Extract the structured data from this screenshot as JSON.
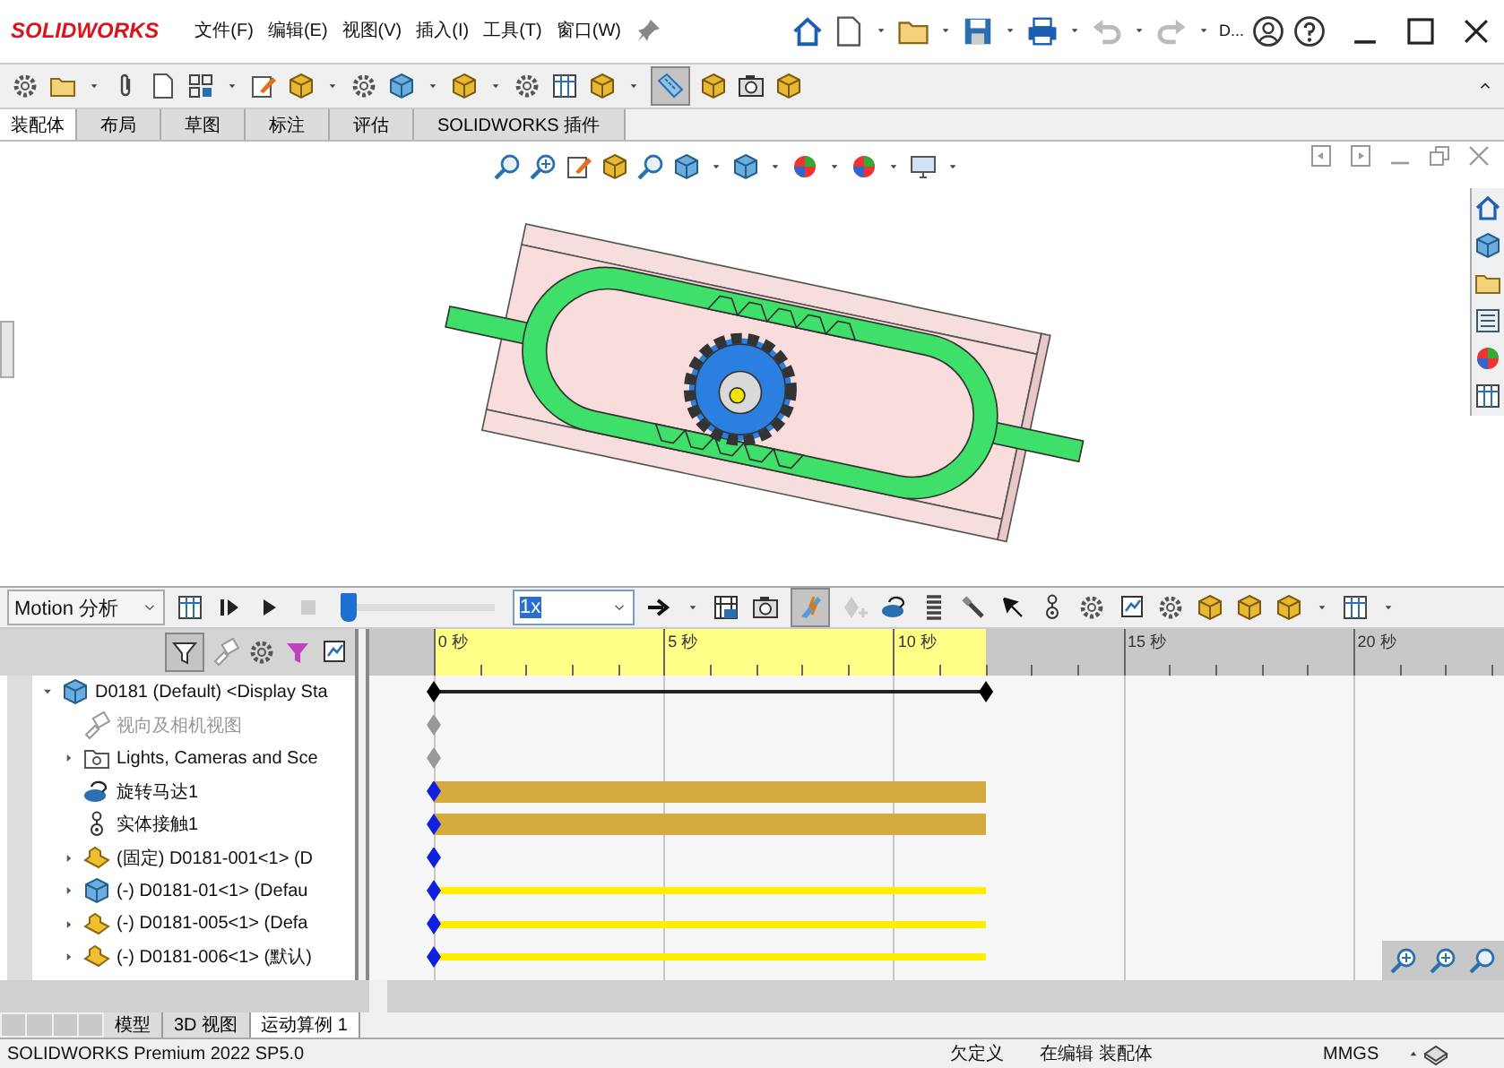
{
  "app": {
    "logo": "SOLIDWORKS",
    "menus": [
      "文件(F)",
      "编辑(E)",
      "视图(V)",
      "插入(I)",
      "工具(T)",
      "窗口(W)"
    ],
    "doc_title": "D..."
  },
  "command_toolbar": {
    "measure_pressed": true
  },
  "command_tabs": [
    {
      "label": "装配体",
      "selected": true
    },
    {
      "label": "布局",
      "selected": false
    },
    {
      "label": "草图",
      "selected": false
    },
    {
      "label": "标注",
      "selected": false
    },
    {
      "label": "评估",
      "selected": false
    },
    {
      "label": "SOLIDWORKS 插件",
      "selected": false
    }
  ],
  "motion": {
    "study_type": "Motion 分析",
    "slider": {
      "level": 0
    },
    "speed": "1x",
    "calc_pressed": true,
    "filter_pressed": true
  },
  "ruler": {
    "level": 0.516,
    "ticks": [
      "0 秒",
      "5 秒",
      "10 秒",
      "15 秒",
      "20 秒"
    ]
  },
  "tree": [
    {
      "label": "D0181 (Default) <Display Sta",
      "kind": "span",
      "expanded": true,
      "children": [
        {
          "label": "视向及相机视图",
          "kind": "key",
          "disabled": true
        },
        {
          "label": "Lights, Cameras and Sce",
          "kind": "key",
          "expanded": false
        },
        {
          "label": "旋转马达1",
          "kind": "bar"
        },
        {
          "label": "实体接触1",
          "kind": "bar"
        },
        {
          "label": "(固定) D0181-001<1> (D",
          "kind": "diamond",
          "expanded": false
        },
        {
          "label": "(-) D0181-01<1> (Defau",
          "kind": "line",
          "expanded": false
        },
        {
          "label": "(-) D0181-005<1> (Defa",
          "kind": "line",
          "expanded": false
        },
        {
          "label": "(-) D0181-006<1> (默认)",
          "kind": "line",
          "expanded": false
        }
      ]
    }
  ],
  "bottom_tabs": [
    {
      "label": "模型",
      "selected": false
    },
    {
      "label": "3D 视图",
      "selected": false
    },
    {
      "label": "运动算例 1",
      "selected": true
    }
  ],
  "status_bar": {
    "product": "SOLIDWORKS Premium 2022 SP5.0",
    "state": "欠定义",
    "mode": "在编辑 装配体",
    "units": "MMGS"
  }
}
